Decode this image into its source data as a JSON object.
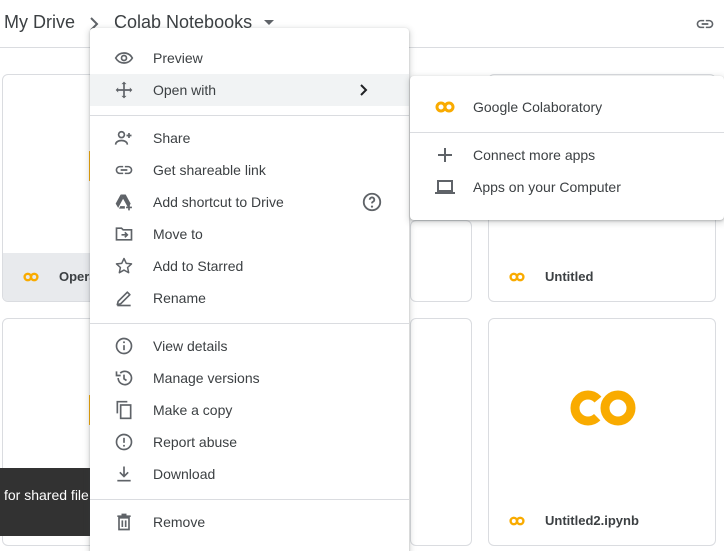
{
  "header": {
    "breadcrumb_root": "My Drive",
    "breadcrumb_current": "Colab Notebooks"
  },
  "files": [
    {
      "name": "Opera"
    },
    {
      "name": "Untitled"
    },
    {
      "name": "Untitled2.ipynb"
    }
  ],
  "snackbar": {
    "text": "for shared file"
  },
  "context_menu": {
    "items": [
      {
        "label": "Preview",
        "icon": "eye-icon"
      },
      {
        "label": "Open with",
        "icon": "move-icon"
      },
      {
        "label": "Share",
        "icon": "add-person-icon"
      },
      {
        "label": "Get shareable link",
        "icon": "link-icon"
      },
      {
        "label": "Add shortcut to Drive",
        "icon": "drive-shortcut-icon"
      },
      {
        "label": "Move to",
        "icon": "move-to-folder-icon"
      },
      {
        "label": "Add to Starred",
        "icon": "star-icon"
      },
      {
        "label": "Rename",
        "icon": "pencil-icon"
      },
      {
        "label": "View details",
        "icon": "info-icon"
      },
      {
        "label": "Manage versions",
        "icon": "history-icon"
      },
      {
        "label": "Make a copy",
        "icon": "copy-icon"
      },
      {
        "label": "Report abuse",
        "icon": "report-icon"
      },
      {
        "label": "Download",
        "icon": "download-icon"
      },
      {
        "label": "Remove",
        "icon": "trash-icon"
      }
    ]
  },
  "open_with_submenu": {
    "items": [
      {
        "label": "Google Colaboratory",
        "icon": "colab-icon"
      },
      {
        "label": "Connect more apps",
        "icon": "plus-icon"
      },
      {
        "label": "Apps on your Computer",
        "icon": "laptop-icon"
      }
    ]
  },
  "colors": {
    "colab_yellow": "#f9ab00",
    "menu_highlight": "#f1f3f4",
    "selected_card": "#e8eaed",
    "icon_gray": "#5f6368"
  }
}
